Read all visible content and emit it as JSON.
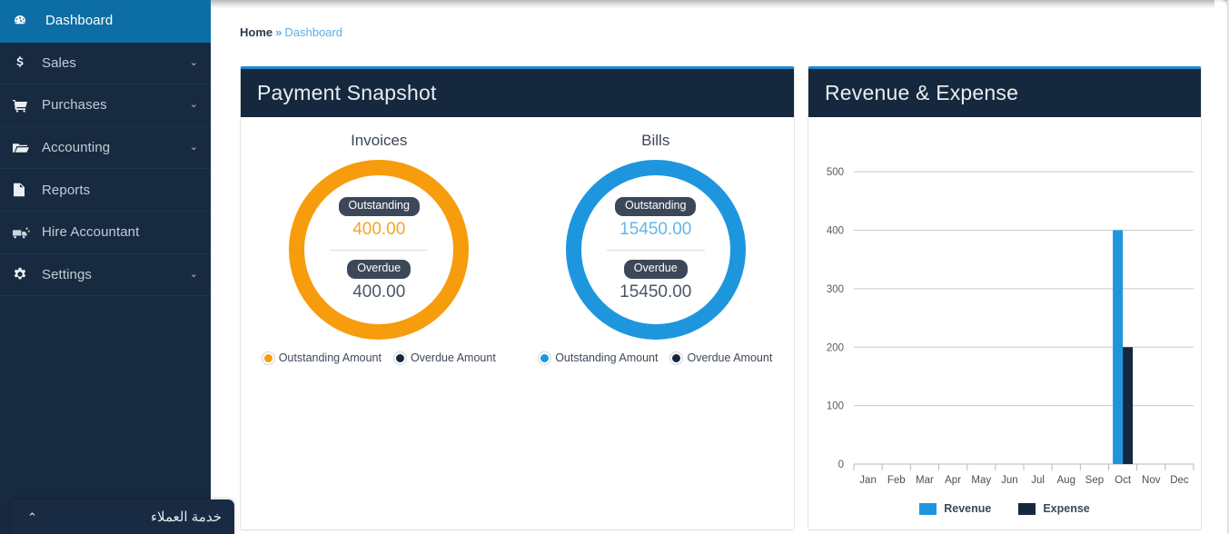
{
  "app": {
    "colors": {
      "sidebar_bg": "#172a40",
      "sidebar_active": "#0d6ea5",
      "card_header_bg": "#16283d",
      "card_top_border": "#1a8bd0",
      "accent_blue": "#1e96de",
      "accent_orange": "#f79c0c",
      "accent_navy": "#16283d"
    }
  },
  "sidebar": {
    "items": [
      {
        "label": "Dashboard",
        "icon": "dashboard-gauge-icon",
        "active": true,
        "caret": ""
      },
      {
        "label": "Sales",
        "icon": "dollar-icon",
        "active": false,
        "caret": "⌄"
      },
      {
        "label": "Purchases",
        "icon": "cart-icon",
        "active": false,
        "caret": "⌄"
      },
      {
        "label": "Accounting",
        "icon": "folder-open-icon",
        "active": false,
        "caret": "⌄"
      },
      {
        "label": "Reports",
        "icon": "document-icon",
        "active": false,
        "caret": ""
      },
      {
        "label": "Hire Accountant",
        "icon": "truck-icon",
        "active": false,
        "caret": ""
      },
      {
        "label": "Settings",
        "icon": "gear-icon",
        "active": false,
        "caret": "⌄"
      }
    ]
  },
  "chat_widget": {
    "label": "خدمة العملاء",
    "caret": "⌃",
    "icon": "chevron-up-icon"
  },
  "breadcrumb": {
    "home": "Home",
    "separator": "»",
    "current": "Dashboard"
  },
  "payment_snapshot": {
    "title": "Payment Snapshot",
    "groups": [
      {
        "caption": "Invoices",
        "color": "#f79c0c",
        "outstanding_label": "Outstanding",
        "outstanding_value": "400.00",
        "overdue_label": "Overdue",
        "overdue_value": "400.00",
        "legend": [
          {
            "label": "Outstanding Amount",
            "color": "#f79c0c"
          },
          {
            "label": "Overdue Amount",
            "color": "#16283d"
          }
        ]
      },
      {
        "caption": "Bills",
        "color": "#1e96de",
        "outstanding_label": "Outstanding",
        "outstanding_value": "15450.00",
        "overdue_label": "Overdue",
        "overdue_value": "15450.00",
        "legend": [
          {
            "label": "Outstanding Amount",
            "color": "#1e96de"
          },
          {
            "label": "Overdue Amount",
            "color": "#16283d"
          }
        ]
      }
    ]
  },
  "revenue_expense": {
    "title": "Revenue & Expense"
  },
  "chart_data": {
    "type": "bar",
    "title": "Revenue & Expense",
    "xlabel": "",
    "ylabel": "",
    "ylim": [
      0,
      550
    ],
    "yticks": [
      0,
      100,
      200,
      300,
      400,
      500
    ],
    "grid": true,
    "legend_position": "bottom",
    "categories": [
      "Jan",
      "Feb",
      "Mar",
      "Apr",
      "May",
      "Jun",
      "Jul",
      "Aug",
      "Sep",
      "Oct",
      "Nov",
      "Dec"
    ],
    "series": [
      {
        "name": "Revenue",
        "color": "#1e96de",
        "values": [
          0,
          0,
          0,
          0,
          0,
          0,
          0,
          0,
          0,
          400,
          0,
          0
        ]
      },
      {
        "name": "Expense",
        "color": "#16283d",
        "values": [
          0,
          0,
          0,
          0,
          0,
          0,
          0,
          0,
          0,
          200,
          0,
          0
        ]
      }
    ]
  }
}
